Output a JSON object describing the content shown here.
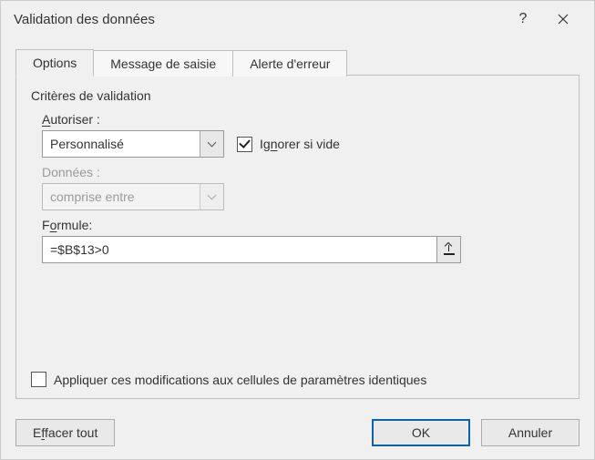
{
  "window": {
    "title": "Validation des données"
  },
  "tabs": {
    "options": "Options",
    "input_msg": "Message de saisie",
    "error_alert": "Alerte d'erreur"
  },
  "criteria": {
    "section_title": "Critères de validation",
    "allow_label_pre": "A",
    "allow_label_post": "utoriser :",
    "allow_value": "Personnalisé",
    "ignore_blank_pre": "Ig",
    "ignore_blank_u": "n",
    "ignore_blank_post": "orer si vide",
    "data_label": "Données :",
    "data_value": "comprise entre",
    "formula_label_pre": "F",
    "formula_label_u": "o",
    "formula_label_post": "rmule:",
    "formula_value": "=$B$13>0",
    "apply_label": "Appliquer ces modifications aux cellules de paramètres identiques"
  },
  "buttons": {
    "clear_pre": "E",
    "clear_u": "f",
    "clear_post": "facer tout",
    "ok": "OK",
    "cancel": "Annuler"
  }
}
